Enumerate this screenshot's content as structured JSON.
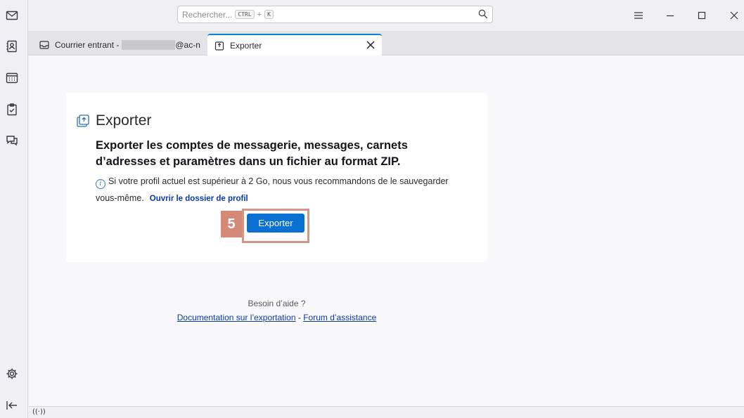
{
  "search": {
    "placeholder": "Rechercher...",
    "shortcut_ctrl": "CTRL",
    "shortcut_plus": "+",
    "shortcut_key": "K"
  },
  "tabs": [
    {
      "label": "Courrier entrant - ",
      "suffix": "@ac-n"
    },
    {
      "label": "Exporter"
    }
  ],
  "card": {
    "title": "Exporter",
    "subtitle": "Exporter les comptes de messagerie, messages, carnets d’adresses et paramètres dans un fichier au format ZIP.",
    "info_text": "Si votre profil actuel est supérieur à 2 Go, nous vous recommandons de le sauvegarder vous-même.",
    "profile_link": "Ouvrir le dossier de profil",
    "export_button": "Exporter",
    "step_badge": "5"
  },
  "help": {
    "question": "Besoin d’aide ?",
    "doc_link": "Documentation sur l’exportation",
    "separator": "-",
    "forum_link": "Forum d’assistance"
  },
  "status": {
    "icon": "((·))"
  },
  "colors": {
    "accent": "#0a70d2",
    "step_highlight": "#d48a76"
  }
}
